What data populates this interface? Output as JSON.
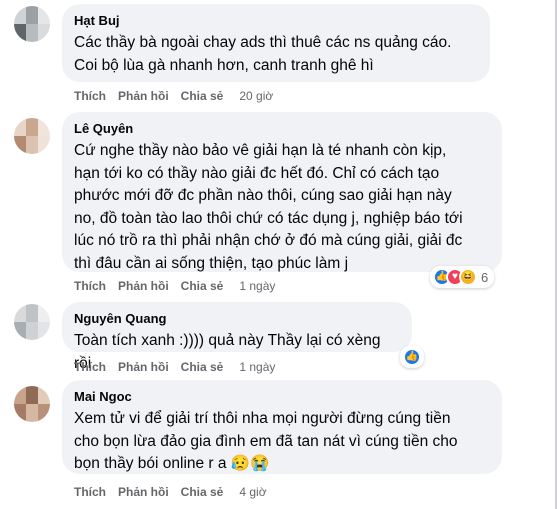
{
  "comments": [
    {
      "name": "Hạt Buj",
      "text": "Các thầy bà ngoài chay ads thì thuê các ns quảng cáo.\nCoi bộ lùa gà nhanh hơn, canh tranh ghê hì",
      "actions": {
        "like": "Thích",
        "reply": "Phản hồi",
        "share": "Chia sẻ",
        "time": "20 giờ"
      },
      "avatar_colors": [
        "#cfd3d6",
        "#9aa0a3",
        "#e4e6e8",
        "#5f6568",
        "#b6bbbf",
        "#d9dcde"
      ]
    },
    {
      "name": "Lê Quyên",
      "text": "Cứ nghe thầy nào bảo vê giải hạn là té nhanh còn kịp,\nhạn tới ko có thầy nào giải đc hết đó. Chỉ có cách tạo\nphước mới đỡ đc phần nào thôi, cúng sao giải hạn này\nno, đồ toàn tào lao thôi chứ có tác dụng j, nghiệp báo tới\nlúc nó trồ ra thì phải nhận chớ ở đó mà cúng giải, giải đc\nthì đâu cần ai sống thiện, tạo phúc làm j",
      "actions": {
        "like": "Thích",
        "reply": "Phản hồi",
        "share": "Chia sẻ",
        "time": "1 ngày"
      },
      "reactions": {
        "icons": [
          "like-icon",
          "love-icon",
          "haha-icon"
        ],
        "count": "6"
      },
      "avatar_colors": [
        "#e8d5c8",
        "#c9a78f",
        "#f2e4da",
        "#b48a70",
        "#dcc2b0",
        "#efe2d8"
      ]
    },
    {
      "name": "Nguyên Quang",
      "text": "Toàn tích xanh :)))) quả này Thầy lại có xèng rồi",
      "actions": {
        "like": "Thích",
        "reply": "Phản hồi",
        "share": "Chia sẻ",
        "time": "1 ngày"
      },
      "reactions": {
        "icons": [
          "like-icon"
        ],
        "count": ""
      },
      "avatar_colors": [
        "#d8dadc",
        "#bfc3c6",
        "#eceeef",
        "#a9aeb2",
        "#cfd2d5",
        "#e2e4e6"
      ]
    },
    {
      "name": "Mai Ngoc",
      "text": "Xem tử vi để giải trí thôi nha mọi người đừng cúng tiền\ncho bọn lừa đảo gia đình em đã tan nát vì cúng tiền cho\nbọn thầy bói online r a 😥😭",
      "actions": {
        "like": "Thích",
        "reply": "Phản hồi",
        "share": "Chia sẻ",
        "time": "4 giờ"
      },
      "avatar_colors": [
        "#c8a48c",
        "#8f6a55",
        "#e3cbb9",
        "#a47c66",
        "#d6b7a1",
        "#b99079"
      ]
    }
  ],
  "colors": {
    "bubble": "#f0f2f5",
    "meta": "#65676b",
    "like": "#1877f2",
    "love": "#f33e58",
    "haha": "#f7b125"
  }
}
